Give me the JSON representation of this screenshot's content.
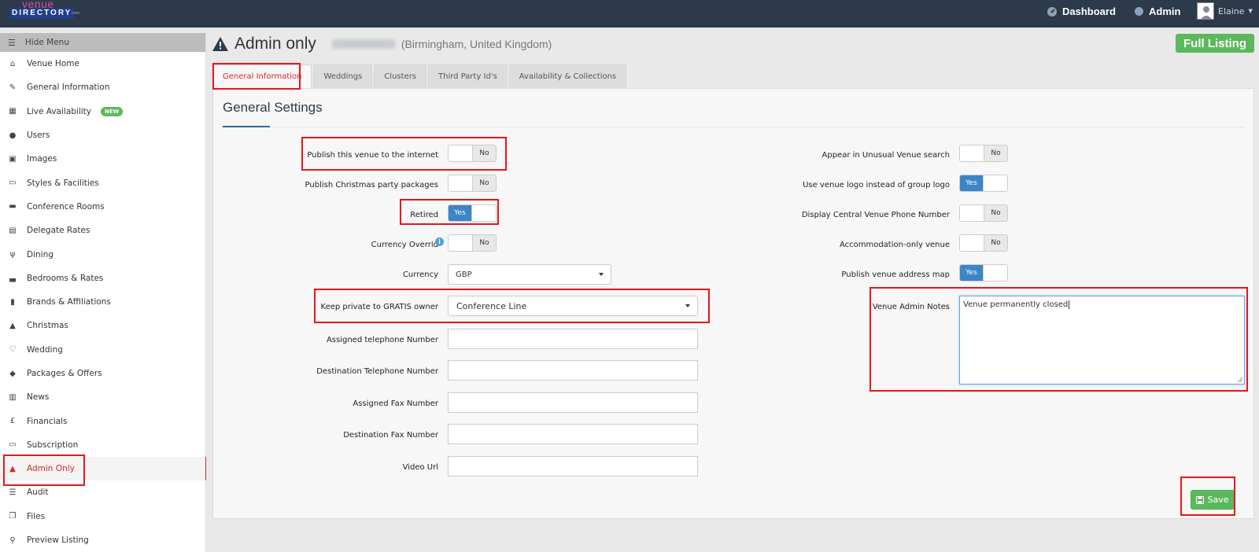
{
  "brand": {
    "line1": "venue",
    "line2": "DIRECTORY",
    "line3": ".com"
  },
  "topnav": {
    "dashboard": "Dashboard",
    "admin": "Admin",
    "user": "Elaine"
  },
  "sidebar": {
    "hide_menu": "Hide Menu",
    "items": [
      {
        "label": "Venue Home",
        "icon": "home-icon"
      },
      {
        "label": "General Information",
        "icon": "edit-icon"
      },
      {
        "label": "Live Availability",
        "icon": "calendar-icon",
        "badge": "NEW"
      },
      {
        "label": "Users",
        "icon": "user-icon"
      },
      {
        "label": "Images",
        "icon": "image-icon"
      },
      {
        "label": "Styles & Facilities",
        "icon": "monitor-icon"
      },
      {
        "label": "Conference Rooms",
        "icon": "briefcase-icon"
      },
      {
        "label": "Delegate Rates",
        "icon": "calculator-icon"
      },
      {
        "label": "Dining",
        "icon": "cutlery-icon"
      },
      {
        "label": "Bedrooms & Rates",
        "icon": "bed-icon"
      },
      {
        "label": "Brands & Affiliations",
        "icon": "book-icon"
      },
      {
        "label": "Christmas",
        "icon": "bell-icon"
      },
      {
        "label": "Wedding",
        "icon": "heart-icon"
      },
      {
        "label": "Packages & Offers",
        "icon": "tags-icon"
      },
      {
        "label": "News",
        "icon": "newspaper-icon"
      },
      {
        "label": "Financials",
        "icon": "pound-icon"
      },
      {
        "label": "Subscription",
        "icon": "credit-card-icon"
      },
      {
        "label": "Admin Only",
        "icon": "warning-icon",
        "active": true
      },
      {
        "label": "Audit",
        "icon": "list-icon"
      },
      {
        "label": "Files",
        "icon": "files-icon"
      },
      {
        "label": "Preview Listing",
        "icon": "search-icon"
      }
    ]
  },
  "header": {
    "title": "Admin only",
    "location": "(Birmingham, United Kingdom)",
    "full_listing": "Full Listing"
  },
  "tabs": [
    "General Information",
    "Weddings",
    "Clusters",
    "Third Party Id's",
    "Availability & Collections"
  ],
  "form": {
    "heading": "General Settings",
    "publish_internet": {
      "label": "Publish this venue to the internet",
      "value": "No"
    },
    "publish_christmas": {
      "label": "Publish Christmas party packages",
      "value": "No"
    },
    "retired": {
      "label": "Retired",
      "value": "Yes"
    },
    "currency_override": {
      "label": "Currency Overrid",
      "value": "No",
      "info": "i"
    },
    "currency": {
      "label": "Currency",
      "value": "GBP"
    },
    "keep_private": {
      "label": "Keep private to GRATIS owner",
      "value": "Conference Line"
    },
    "assigned_phone": {
      "label": "Assigned telephone Number",
      "value": ""
    },
    "dest_phone": {
      "label": "Destination Telephone Number",
      "value": ""
    },
    "assigned_fax": {
      "label": "Assigned Fax Number",
      "value": ""
    },
    "dest_fax": {
      "label": "Destination Fax Number",
      "value": ""
    },
    "video_url": {
      "label": "Video Url",
      "value": ""
    },
    "unusual_search": {
      "label": "Appear in Unusual Venue search",
      "value": "No"
    },
    "venue_logo": {
      "label": "Use venue logo instead of group logo",
      "value": "Yes"
    },
    "central_phone": {
      "label": "Display Central Venue Phone Number",
      "value": "No"
    },
    "accommodation_only": {
      "label": "Accommodation-only venue",
      "value": "No"
    },
    "address_map": {
      "label": "Publish venue address map",
      "value": "Yes"
    },
    "admin_notes": {
      "label": "Venue Admin Notes",
      "value": "Venue permanently closed"
    },
    "save": "Save"
  }
}
